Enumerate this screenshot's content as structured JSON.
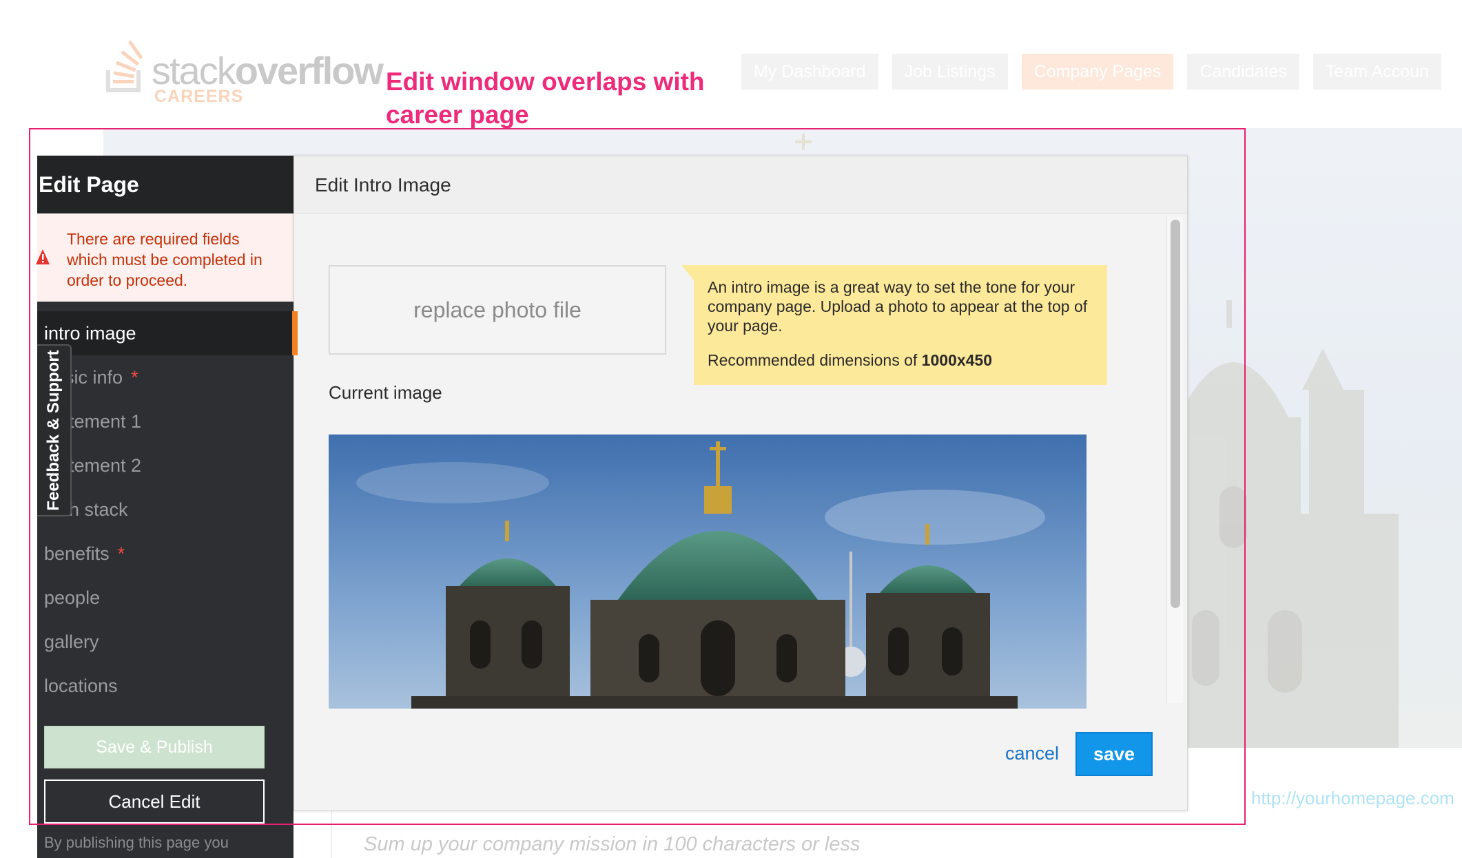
{
  "site": {
    "logo_word1": "stack",
    "logo_word2": "overflow",
    "logo_sub": "CAREERS",
    "nav": [
      "My Dashboard",
      "Job Listings",
      "Company Pages",
      "Candidates",
      "Team Accoun"
    ],
    "nav_active": "Company Pages",
    "homepage_link": "http://yourhomepage.com",
    "mission_placeholder": "Sum up your company mission in 100 characters or less"
  },
  "annotation": {
    "text": "Edit window overlaps with career page",
    "color": "#e8206f"
  },
  "sidebar": {
    "title": "Edit Page",
    "error": "There are required fields which must be completed in order to proceed.",
    "items": [
      {
        "label": "intro image",
        "required": false,
        "active": true
      },
      {
        "label": "basic info",
        "required": true,
        "active": false
      },
      {
        "label": "statement 1",
        "required": false,
        "active": false
      },
      {
        "label": "statement 2",
        "required": false,
        "active": false
      },
      {
        "label": "tech stack",
        "required": false,
        "active": false
      },
      {
        "label": "benefits",
        "required": true,
        "active": false
      },
      {
        "label": "people",
        "required": false,
        "active": false
      },
      {
        "label": "gallery",
        "required": false,
        "active": false
      },
      {
        "label": "locations",
        "required": false,
        "active": false
      }
    ],
    "required_marker": "*",
    "publish_label": "Save & Publish",
    "cancel_edit_label": "Cancel Edit",
    "footnote": "By publishing this page you"
  },
  "feedback": {
    "label": "Feedback & Support"
  },
  "modal": {
    "title": "Edit Intro Image",
    "replace_label": "replace photo file",
    "tip_text": "An intro image is a great way to set the tone for your company page. Upload a photo to appear at the top of your page.",
    "tip_dims_prefix": "Recommended dimensions of ",
    "tip_dims_value": "1000x450",
    "current_image_label": "Current image",
    "cancel_label": "cancel",
    "save_label": "save"
  },
  "colors": {
    "accent_orange": "#f48024",
    "save_blue": "#1296ea",
    "link_blue": "#1a73c7",
    "error_red": "#c3310a",
    "tip_yellow": "#fde99a"
  }
}
